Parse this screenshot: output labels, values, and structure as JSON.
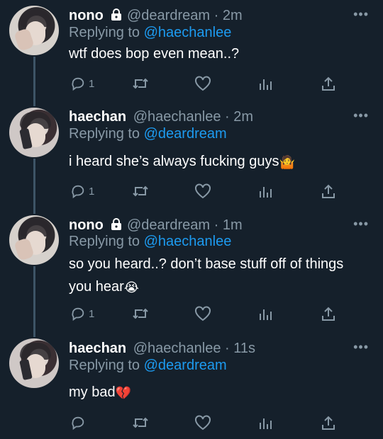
{
  "tweets": [
    {
      "name": "nono",
      "handle": "@deardream",
      "dot": "·",
      "time": "2m",
      "reply_prefix": "Replying to",
      "reply_to": "@haechanlee",
      "text_lines": [
        "wtf does bop even mean..?"
      ],
      "reply_count": "1",
      "locked": true,
      "avatar": "nono"
    },
    {
      "name": "haechan",
      "handle": "@haechanlee",
      "dot": "·",
      "time": "2m",
      "reply_prefix": "Replying to",
      "reply_to": "@deardream",
      "text_lines": [
        "i heard she’s always fucking guys"
      ],
      "trailing_emoji": "🤷",
      "reply_count": "1",
      "locked": false,
      "avatar": "haechan"
    },
    {
      "name": "nono",
      "handle": "@deardream",
      "dot": "·",
      "time": "1m",
      "reply_prefix": "Replying to",
      "reply_to": "@haechanlee",
      "text_lines": [
        "so you heard..? don’t base stuff off of things",
        "you hear"
      ],
      "trailing_emoji": "😭",
      "reply_count": "1",
      "locked": true,
      "avatar": "nono"
    },
    {
      "name": "haechan",
      "handle": "@haechanlee",
      "dot": "·",
      "time": "11s",
      "reply_prefix": "Replying to",
      "reply_to": "@deardream",
      "text_lines": [
        "my bad"
      ],
      "trailing_emoji": "💔",
      "reply_count": "",
      "locked": false,
      "avatar": "haechan"
    }
  ],
  "more_label": "•••",
  "icons": [
    "reply-icon",
    "retweet-icon",
    "like-icon",
    "analytics-icon",
    "share-icon",
    "lock-icon",
    "more-icon"
  ],
  "colors": {
    "background": "#15202b",
    "text": "#ffffff",
    "muted": "#8899a6",
    "link": "#1d9bf0",
    "thread": "#3d5466"
  }
}
